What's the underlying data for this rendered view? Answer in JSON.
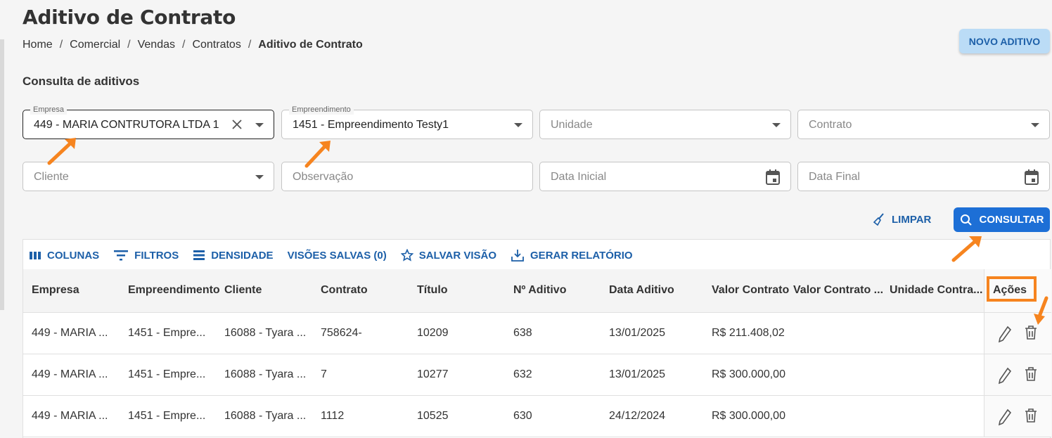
{
  "page": {
    "title": "Aditivo de Contrato",
    "breadcrumb": [
      "Home",
      "Comercial",
      "Vendas",
      "Contratos",
      "Aditivo de Contrato"
    ],
    "novo_button": "NOVO ADITIVO",
    "section_title": "Consulta de aditivos"
  },
  "filters": {
    "empresa": {
      "label": "Empresa",
      "value": "449 - MARIA CONTRUTORA LTDA 1"
    },
    "empreendimento": {
      "label": "Empreendimento",
      "value": "1451 - Empreendimento Testy1"
    },
    "unidade": {
      "placeholder": "Unidade"
    },
    "contrato": {
      "placeholder": "Contrato"
    },
    "cliente": {
      "placeholder": "Cliente"
    },
    "observacao": {
      "placeholder": "Observação"
    },
    "data_inicial": {
      "placeholder": "Data Inicial"
    },
    "data_final": {
      "placeholder": "Data Final"
    },
    "limpar_label": "LIMPAR",
    "consultar_label": "CONSULTAR"
  },
  "toolbar": {
    "colunas": "COLUNAS",
    "filtros": "FILTROS",
    "densidade": "DENSIDADE",
    "visoes": "VISÕES SALVAS (0)",
    "salvar_visao": "SALVAR VISÃO",
    "gerar_relatorio": "GERAR RELATÓRIO"
  },
  "table": {
    "columns": [
      "Empresa",
      "Empreendimento",
      "Cliente",
      "Contrato",
      "Título",
      "Nº Aditivo",
      "Data Aditivo",
      "Valor Contrato",
      "Valor Contrato ...",
      "Unidade Contra...",
      "Ações"
    ],
    "rows": [
      [
        "449 - MARIA ...",
        "1451 - Empre...",
        "16088 - Tyara ...",
        "758624-",
        "10209",
        "638",
        "13/01/2025",
        "R$ 211.408,02"
      ],
      [
        "449 - MARIA ...",
        "1451 - Empre...",
        "16088 - Tyara ...",
        "7",
        "10277",
        "632",
        "13/01/2025",
        "R$ 300.000,00"
      ],
      [
        "449 - MARIA ...",
        "1451 - Empre...",
        "16088 - Tyara ...",
        "1112",
        "10525",
        "630",
        "24/12/2024",
        "R$ 300.000,00"
      ]
    ]
  },
  "colors": {
    "accent": "#1d6fd6",
    "link": "#1c5fa8",
    "annotation": "#f6841f"
  }
}
